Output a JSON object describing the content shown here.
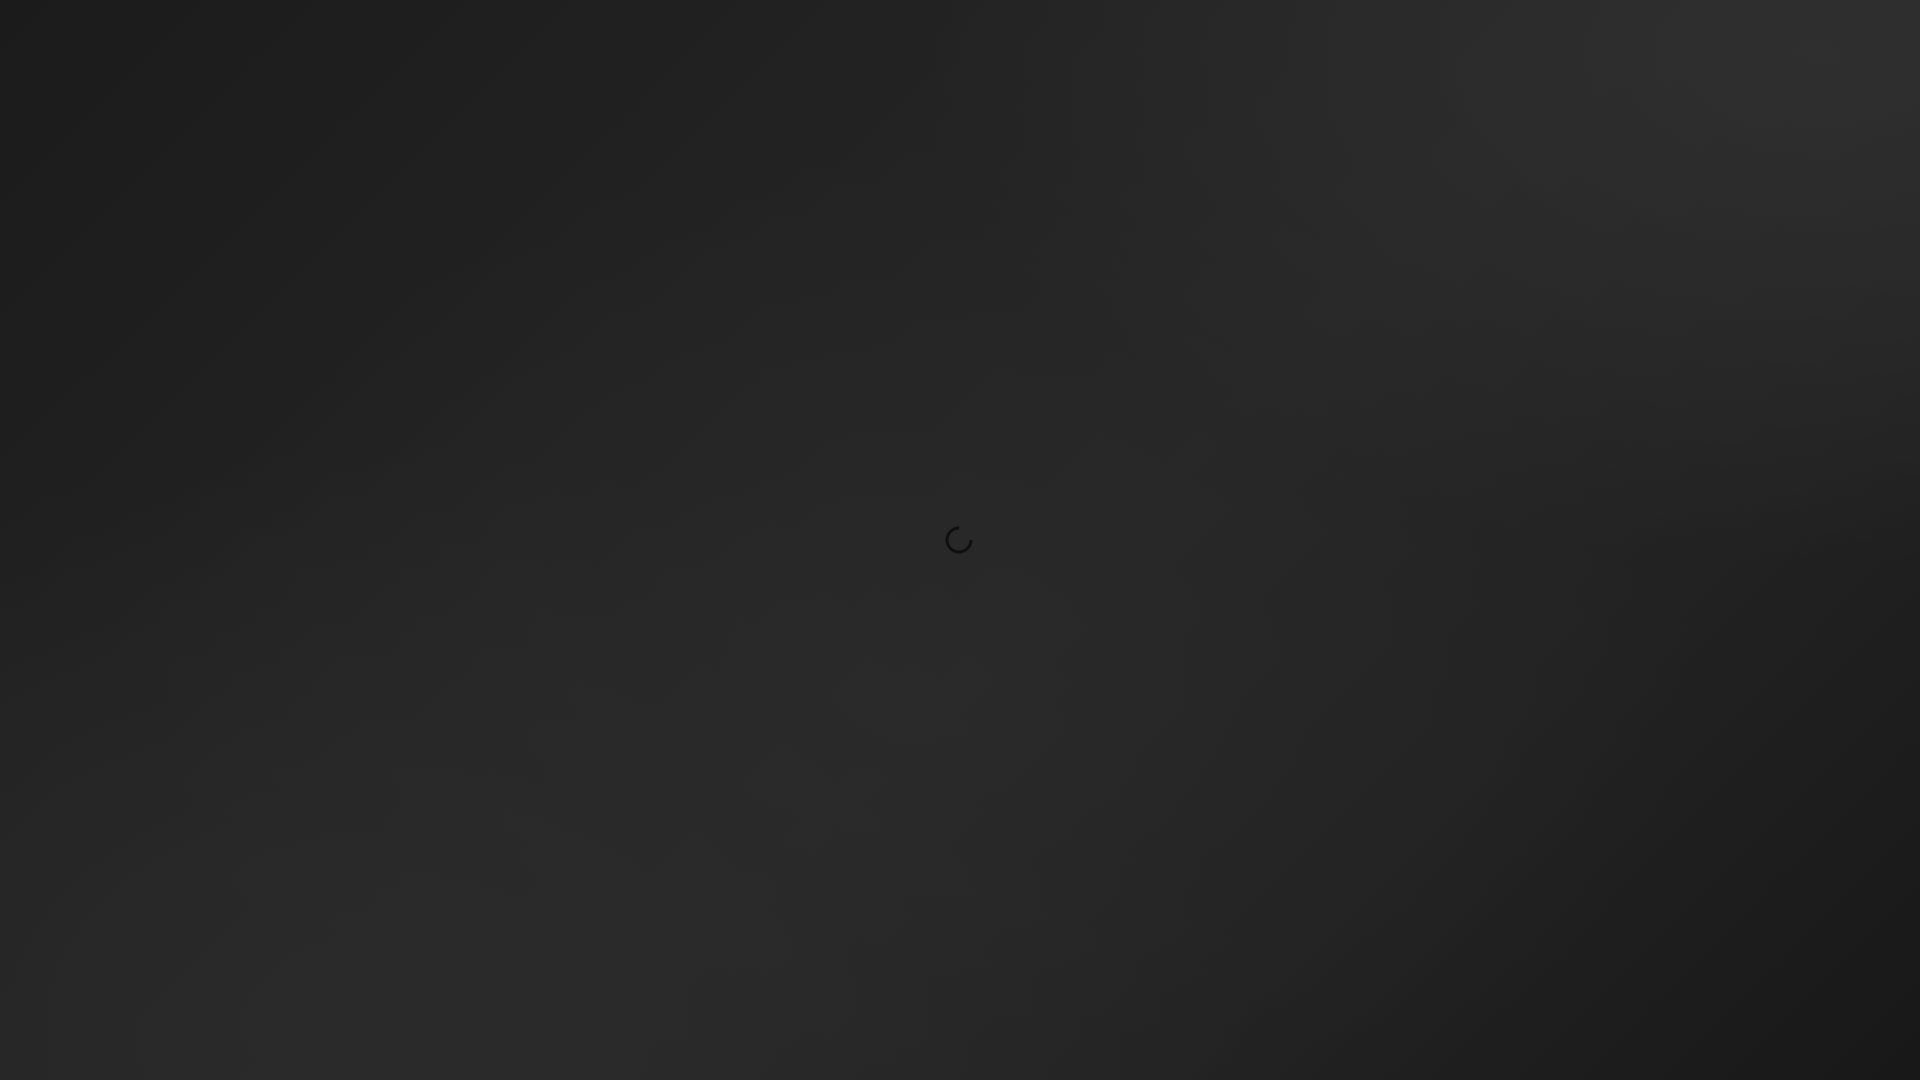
{
  "loading": {
    "state": "loading",
    "indicator_icon": "spinner-icon",
    "indicator_color": "#0f0f0f"
  },
  "background": {
    "base_color": "#1e1e1e",
    "highlight_color": "#2a2a2a"
  }
}
